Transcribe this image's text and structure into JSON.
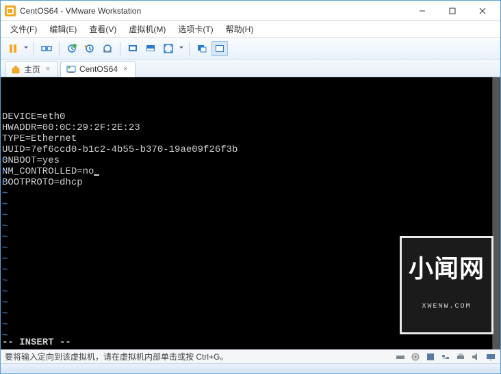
{
  "window": {
    "title": "CentOS64 - VMware Workstation"
  },
  "menu": {
    "file": "文件(F)",
    "edit": "编辑(E)",
    "view": "查看(V)",
    "vm": "虚拟机(M)",
    "tabs": "选项卡(T)",
    "help": "帮助(H)"
  },
  "tabs": {
    "home": "主页",
    "vm1": "CentOS64"
  },
  "terminal": {
    "lines": [
      "DEVICE=eth0",
      "HWADDR=00:0C:29:2F:2E:23",
      "TYPE=Ethernet",
      "UUID=7ef6ccd0-b1c2-4b55-b370-19ae09f26f3b",
      "ONBOOT=yes",
      "NM_CONTROLLED=no",
      "BOOTPROTO=dhcp"
    ],
    "mode": "-- INSERT --"
  },
  "watermark": {
    "big": "小闻网",
    "small": "XWENW.COM"
  },
  "status": {
    "hint": "要将输入定向到该虚拟机，请在虚拟机内部单击或按 Ctrl+G。"
  }
}
